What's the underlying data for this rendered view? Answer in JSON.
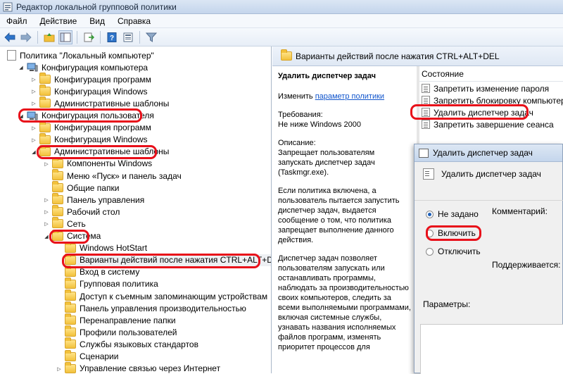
{
  "window": {
    "title": "Редактор локальной групповой политики"
  },
  "menu": [
    "Файл",
    "Действие",
    "Вид",
    "Справка"
  ],
  "tree": [
    {
      "label": "Политика \"Локальный компьютер\"",
      "indent": 0,
      "icon": "doc",
      "expander": ""
    },
    {
      "label": "Конфигурация компьютера",
      "indent": 1,
      "icon": "pc",
      "expander": "open"
    },
    {
      "label": "Конфигурация программ",
      "indent": 2,
      "icon": "folder",
      "expander": "closed"
    },
    {
      "label": "Конфигурация Windows",
      "indent": 2,
      "icon": "folder",
      "expander": "closed"
    },
    {
      "label": "Административные шаблоны",
      "indent": 2,
      "icon": "folder",
      "expander": "closed"
    },
    {
      "label": "Конфигурация пользователя",
      "indent": 1,
      "icon": "pc",
      "expander": "open",
      "highlight": true
    },
    {
      "label": "Конфигурация программ",
      "indent": 2,
      "icon": "folder",
      "expander": "closed"
    },
    {
      "label": "Конфигурация Windows",
      "indent": 2,
      "icon": "folder",
      "expander": "closed"
    },
    {
      "label": "Административные шаблоны",
      "indent": 2,
      "icon": "folder",
      "expander": "open",
      "highlight": true
    },
    {
      "label": "Компоненты Windows",
      "indent": 3,
      "icon": "folder",
      "expander": "closed"
    },
    {
      "label": "Меню «Пуск» и панель задач",
      "indent": 3,
      "icon": "folder",
      "expander": ""
    },
    {
      "label": "Общие папки",
      "indent": 3,
      "icon": "folder",
      "expander": ""
    },
    {
      "label": "Панель управления",
      "indent": 3,
      "icon": "folder",
      "expander": "closed"
    },
    {
      "label": "Рабочий стол",
      "indent": 3,
      "icon": "folder",
      "expander": "closed"
    },
    {
      "label": "Сеть",
      "indent": 3,
      "icon": "folder",
      "expander": "closed"
    },
    {
      "label": "Система",
      "indent": 3,
      "icon": "folder",
      "expander": "open",
      "highlight": true
    },
    {
      "label": "Windows HotStart",
      "indent": 4,
      "icon": "folder",
      "expander": ""
    },
    {
      "label": "Варианты действий после нажатия CTRL+ALT+DEL",
      "indent": 4,
      "icon": "folder",
      "expander": "",
      "highlight": true,
      "selected": true
    },
    {
      "label": "Вход в систему",
      "indent": 4,
      "icon": "folder",
      "expander": ""
    },
    {
      "label": "Групповая политика",
      "indent": 4,
      "icon": "folder",
      "expander": ""
    },
    {
      "label": "Доступ к съемным запоминающим устройствам",
      "indent": 4,
      "icon": "folder",
      "expander": ""
    },
    {
      "label": "Панель управления производительностью",
      "indent": 4,
      "icon": "folder",
      "expander": ""
    },
    {
      "label": "Перенаправление папки",
      "indent": 4,
      "icon": "folder",
      "expander": ""
    },
    {
      "label": "Профили пользователей",
      "indent": 4,
      "icon": "folder",
      "expander": ""
    },
    {
      "label": "Службы языковых стандартов",
      "indent": 4,
      "icon": "folder",
      "expander": ""
    },
    {
      "label": "Сценарии",
      "indent": 4,
      "icon": "folder",
      "expander": ""
    },
    {
      "label": "Управление связью через Интернет",
      "indent": 4,
      "icon": "folder",
      "expander": "closed"
    }
  ],
  "right_header": "Варианты действий после нажатия CTRL+ALT+DEL",
  "description": {
    "title": "Удалить диспетчер задач",
    "edit_prefix": "Изменить",
    "edit_link": "параметр политики",
    "requirements_label": "Требования:",
    "requirements_value": "Не ниже Windows 2000",
    "description_label": "Описание:",
    "description_text": "Запрещает пользователям запускать диспетчер задач (Taskmgr.exe).",
    "paragraph2": "Если политика включена, а пользователь пытается запустить диспетчер задач, выдается сообщение о том, что политика запрещает выполнение данного действия.",
    "paragraph3": "Диспетчер задач позволяет пользователям запускать или останавливать программы, наблюдать за производительностью своих компьютеров, следить за всеми выполняемыми программами, включая системные службы, узнавать названия исполняемых файлов программ, изменять приоритет процессов для"
  },
  "list": {
    "column": "Состояние",
    "items": [
      {
        "label": "Запретить изменение пароля",
        "highlight": false
      },
      {
        "label": "Запретить блокировку компьютера",
        "highlight": false
      },
      {
        "label": "Удалить диспетчер задач",
        "highlight": true
      },
      {
        "label": "Запретить завершение сеанса",
        "highlight": false
      }
    ]
  },
  "dialog": {
    "title": "Удалить диспетчер задач",
    "subtitle": "Удалить диспетчер задач",
    "options": [
      {
        "label": "Не задано",
        "checked": true
      },
      {
        "label": "Включить",
        "checked": false
      },
      {
        "label": "Отключить",
        "checked": false
      }
    ],
    "comment_label": "Комментарий:",
    "supported_label": "Поддерживается:",
    "params_label": "Параметры:"
  },
  "colors": {
    "highlight_red": "#e8101a",
    "link_blue": "#1155cc"
  }
}
